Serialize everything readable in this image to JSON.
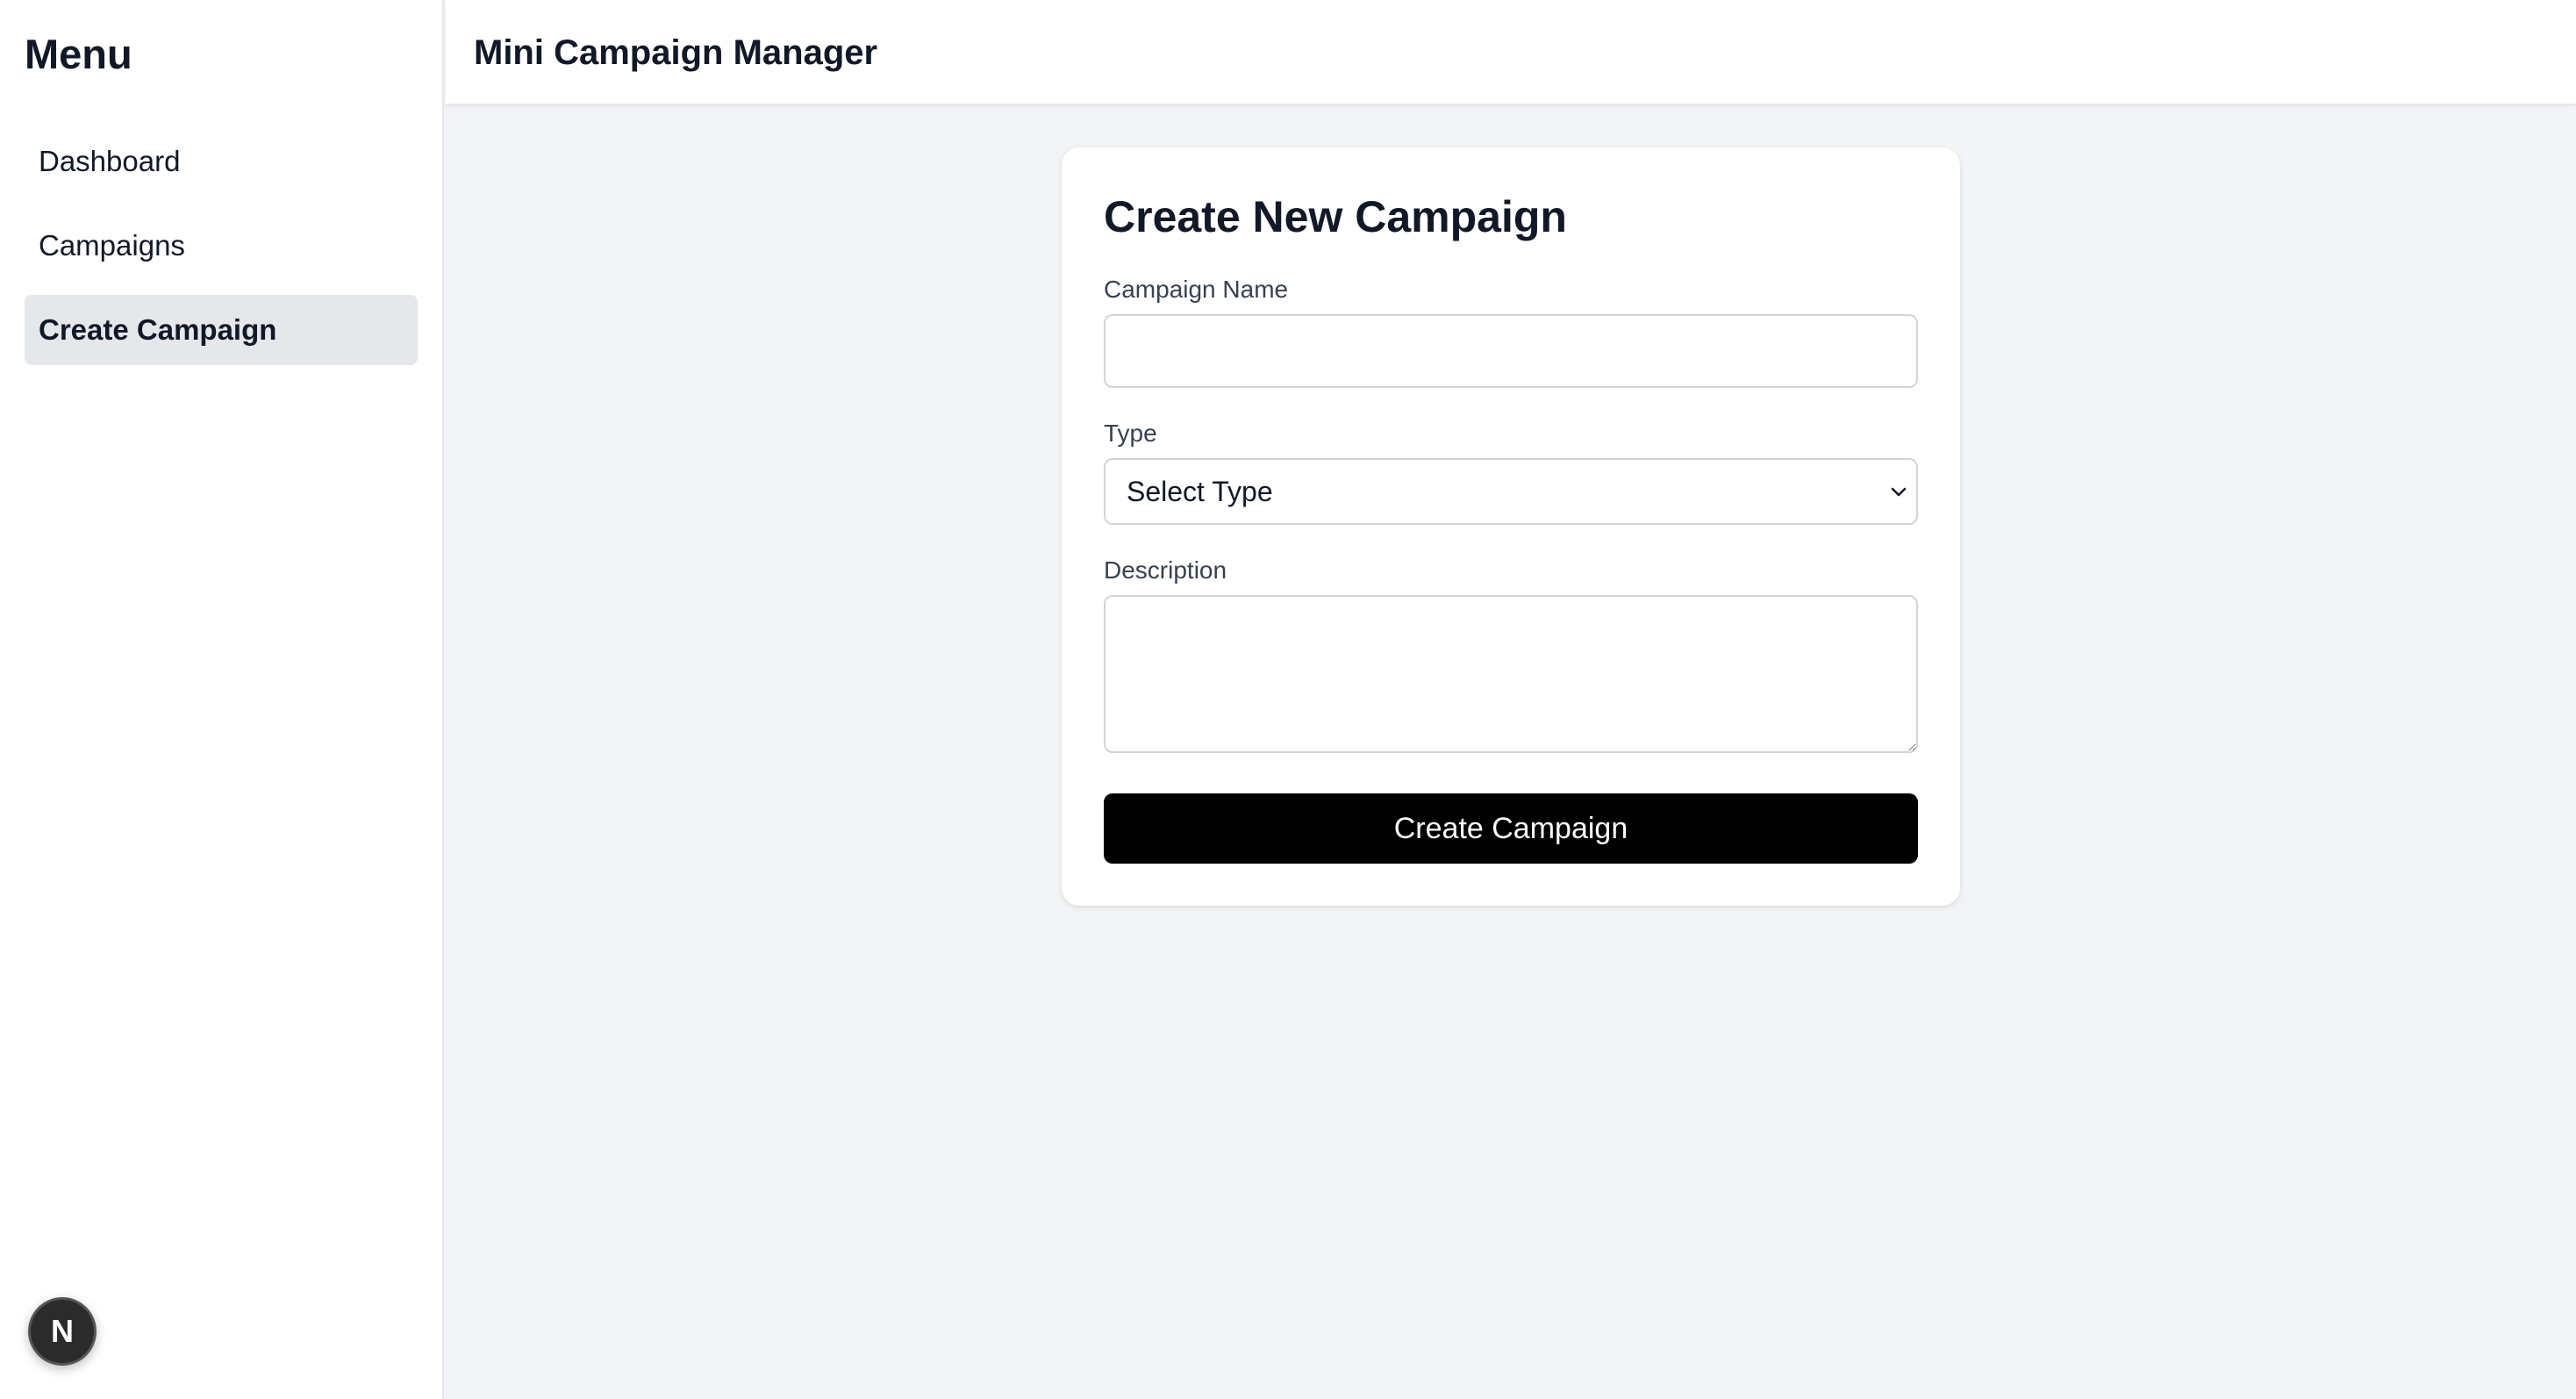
{
  "sidebar": {
    "title": "Menu",
    "items": [
      {
        "label": "Dashboard",
        "active": false
      },
      {
        "label": "Campaigns",
        "active": false
      },
      {
        "label": "Create Campaign",
        "active": true
      }
    ],
    "badge_letter": "N"
  },
  "header": {
    "title": "Mini Campaign Manager"
  },
  "form": {
    "title": "Create New Campaign",
    "name_label": "Campaign Name",
    "name_value": "",
    "type_label": "Type",
    "type_selected": "Select Type",
    "description_label": "Description",
    "description_value": "",
    "submit_label": "Create Campaign"
  },
  "colors": {
    "page_background": "#f3f4f6",
    "active_nav": "#e5e7eb",
    "primary_button": "#000000"
  }
}
